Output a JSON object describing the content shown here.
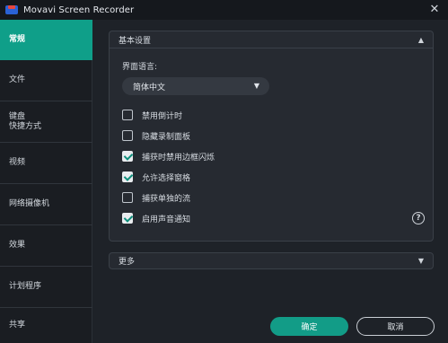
{
  "window": {
    "title": "Movavi Screen Recorder",
    "close_glyph": "✕"
  },
  "sidebar": {
    "items": [
      {
        "label": "常规",
        "active": true
      },
      {
        "label": "文件"
      },
      {
        "label": "键盘\n快捷方式"
      },
      {
        "label": "视频"
      },
      {
        "label": "网络摄像机"
      },
      {
        "label": "效果"
      },
      {
        "label": "计划程序"
      },
      {
        "label": "共享"
      }
    ]
  },
  "basic_settings": {
    "header": "基本设置",
    "language_label": "界面语言:",
    "language_value": "简体中文",
    "options": [
      {
        "label": "禁用倒计时",
        "checked": false
      },
      {
        "label": "隐藏录制面板",
        "checked": false
      },
      {
        "label": "捕获时禁用边框闪烁",
        "checked": true
      },
      {
        "label": "允许选择窗格",
        "checked": true
      },
      {
        "label": "捕获单独的流",
        "checked": false
      },
      {
        "label": "启用声音通知",
        "checked": true
      }
    ],
    "help_glyph": "?"
  },
  "more": {
    "label": "更多"
  },
  "footer": {
    "ok_label": "确定",
    "cancel_label": "取消"
  },
  "colors": {
    "accent": "#129c87",
    "background": "#1e2228",
    "panel": "#262a31"
  }
}
